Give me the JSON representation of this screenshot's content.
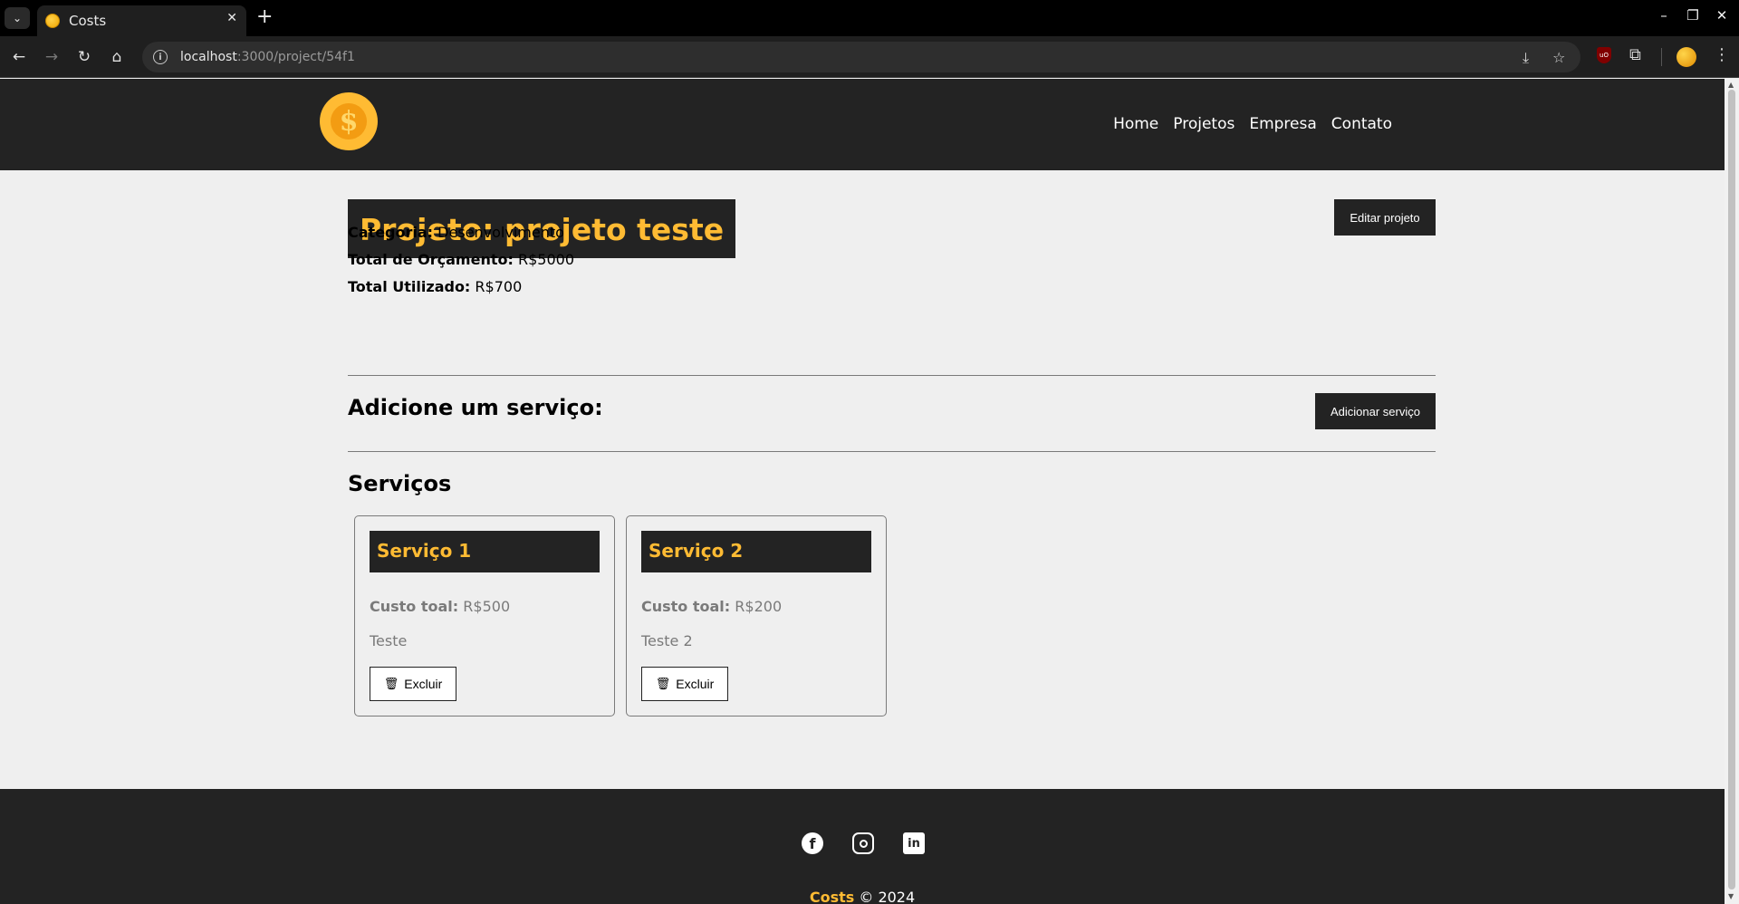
{
  "browser": {
    "tab_title": "Costs",
    "url_host": "localhost",
    "url_path": ":3000/project/54f1",
    "tab_close": "✕",
    "new_tab": "+",
    "tab_list": "⌄",
    "back": "←",
    "forward": "→",
    "reload": "↻",
    "home": "⌂",
    "info": "i",
    "install": "⤓",
    "bookmark": "☆",
    "ublock": "uO",
    "extensions": "⧉",
    "menu": "⋮",
    "minimize": "–",
    "restore": "❐",
    "close": "✕"
  },
  "header": {
    "logo_symbol": "$",
    "nav": [
      "Home",
      "Projetos",
      "Empresa",
      "Contato"
    ]
  },
  "project": {
    "title": "Projeto: projeto teste",
    "edit_button": "Editar projeto",
    "category_label": "Categoria:",
    "category_value": "Desenvolvimento",
    "budget_label": "Total de Orçamento:",
    "budget_value": "R$5000",
    "used_label": "Total Utilizado:",
    "used_value": "R$700"
  },
  "add_service": {
    "title": "Adicione um serviço:",
    "button": "Adicionar serviço"
  },
  "services": {
    "title": "Serviços",
    "cost_label": "Custo toal:",
    "delete_label": "Excluir",
    "trash_icon": "🗑",
    "items": [
      {
        "name": "Serviço 1",
        "cost": "R$500",
        "description": "Teste"
      },
      {
        "name": "Serviço 2",
        "cost": "R$200",
        "description": "Teste 2"
      }
    ]
  },
  "footer": {
    "facebook": "f",
    "linkedin": "in",
    "brand": "Costs",
    "copyright": "© 2024"
  },
  "colors": {
    "header_bg": "#232323",
    "accent": "#ffbb33",
    "page_bg": "#efefef"
  }
}
